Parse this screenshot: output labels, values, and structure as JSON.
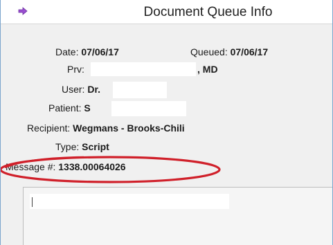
{
  "window": {
    "title": "Document Queue Info",
    "icon": "purple-arrow-icon"
  },
  "fields": {
    "date_label": "Date:",
    "date_value": "07/06/17",
    "queued_label": "Queued:",
    "queued_value": "07/06/17",
    "prv_label": "Prv:",
    "prv_suffix": ", MD",
    "user_label": "User:",
    "user_value": "Dr.",
    "patient_label": "Patient:",
    "patient_value": "S",
    "recipient_label": "Recipient:",
    "recipient_value": "Wegmans - Brooks-Chili",
    "type_label": "Type:",
    "type_value": "Script",
    "message_label": "Message #:",
    "message_value": "1338.00064026"
  },
  "colors": {
    "highlight_ellipse": "#d0202a",
    "icon_purple": "#9b4fd1"
  }
}
